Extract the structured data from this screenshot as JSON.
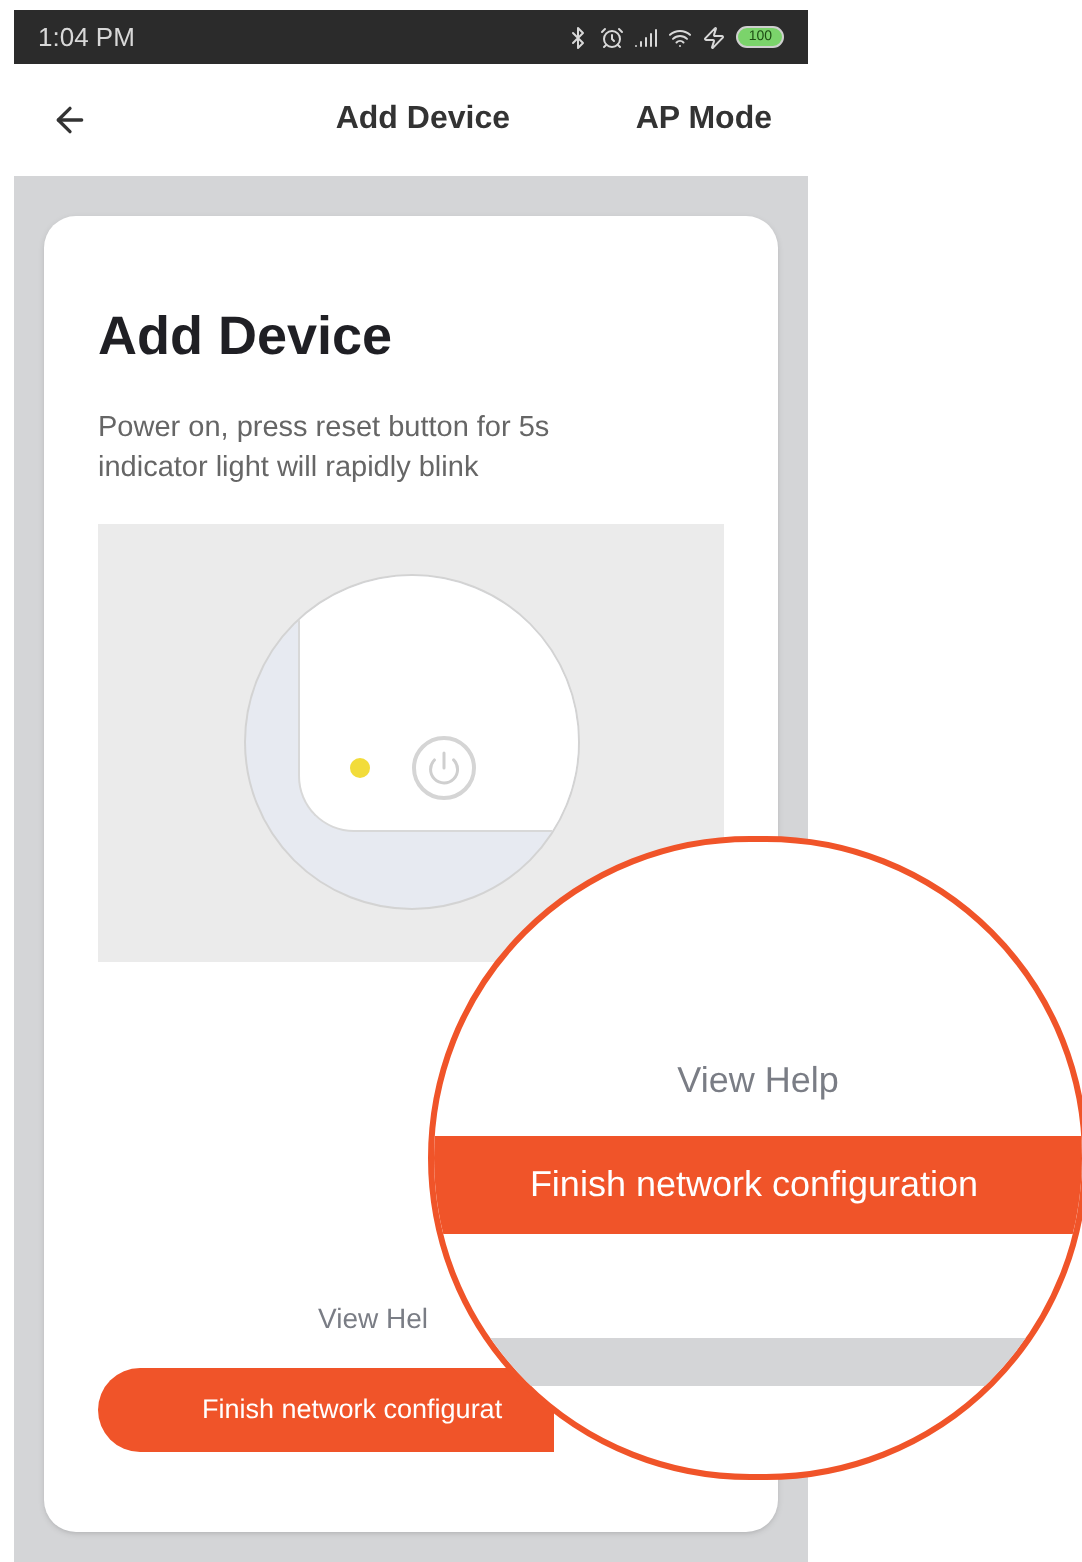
{
  "status_bar": {
    "time": "1:04 PM",
    "battery": "100"
  },
  "header": {
    "title": "Add Device",
    "action": "AP Mode"
  },
  "card": {
    "title": "Add Device",
    "instructions": [
      "Power on, press reset button for 5s",
      "indicator light will rapidly blink"
    ],
    "help_link": "View Hel",
    "button": "Finish network configurat"
  },
  "magnifier": {
    "help_link": "View Help",
    "button": "Finish network configuration"
  }
}
